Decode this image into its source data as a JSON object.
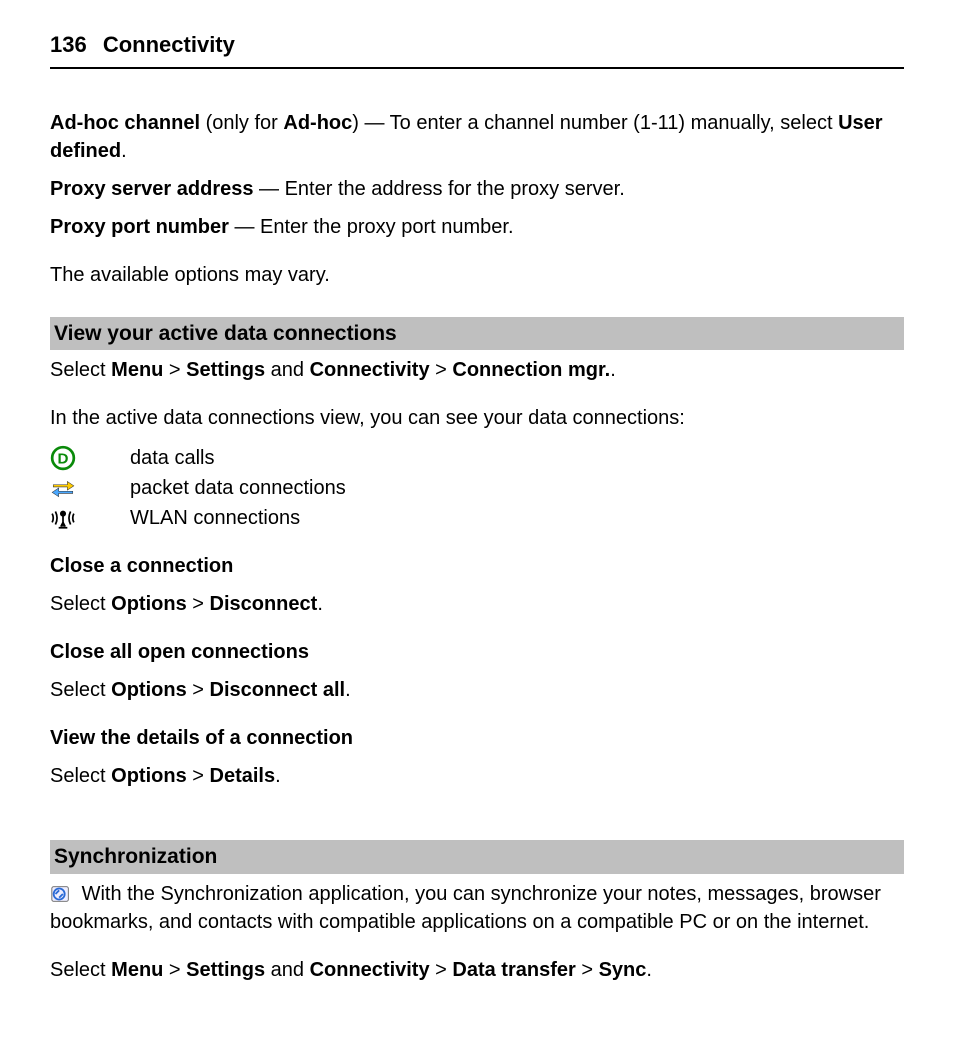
{
  "header": {
    "page_number": "136",
    "section": "Connectivity"
  },
  "adhoc_channel": {
    "label": "Ad-hoc channel",
    "only_for_prefix": " (only for ",
    "only_for_bold": "Ad-hoc",
    "only_for_suffix": ")  — To enter a channel number (1-11) manually, select ",
    "user_defined": "User defined",
    "period": "."
  },
  "proxy_server": {
    "label": "Proxy server address",
    "text": "  — Enter the address for the proxy server."
  },
  "proxy_port": {
    "label": "Proxy port number",
    "text": "  — Enter the proxy port number."
  },
  "options_vary": "The available options may vary.",
  "section1": {
    "title": "View your active data connections",
    "select_word": "Select ",
    "menu": "Menu",
    "gt1": "  > ",
    "settings": "Settings",
    "and": " and ",
    "connectivity": "Connectivity",
    "gt2": "  > ",
    "connmgr": "Connection mgr.",
    "period": ".",
    "intro": "In the active data connections view, you can see your data connections:",
    "icons": {
      "data_calls": "data calls",
      "packet_data": "packet data connections",
      "wlan": "WLAN connections"
    }
  },
  "close_one": {
    "title": "Close a connection",
    "select": "Select ",
    "options": "Options",
    "gt": "  > ",
    "disconnect": "Disconnect",
    "period": "."
  },
  "close_all": {
    "title": "Close all open connections",
    "select": "Select ",
    "options": "Options",
    "gt": "  > ",
    "disconnect_all": "Disconnect all",
    "period": "."
  },
  "view_details": {
    "title": "View the details of a connection",
    "select": "Select ",
    "options": "Options",
    "gt": "  > ",
    "details": "Details",
    "period": "."
  },
  "sync": {
    "title": "Synchronization",
    "intro": " With the Synchronization application, you can synchronize your notes, messages, browser bookmarks, and contacts with compatible applications on a compatible PC or on the internet.",
    "select": "Select ",
    "menu": "Menu",
    "gt1": "  > ",
    "settings": "Settings",
    "and": " and ",
    "connectivity": "Connectivity",
    "gt2": "  > ",
    "data_transfer": "Data transfer",
    "gt3": "  > ",
    "sync": "Sync",
    "period": "."
  }
}
